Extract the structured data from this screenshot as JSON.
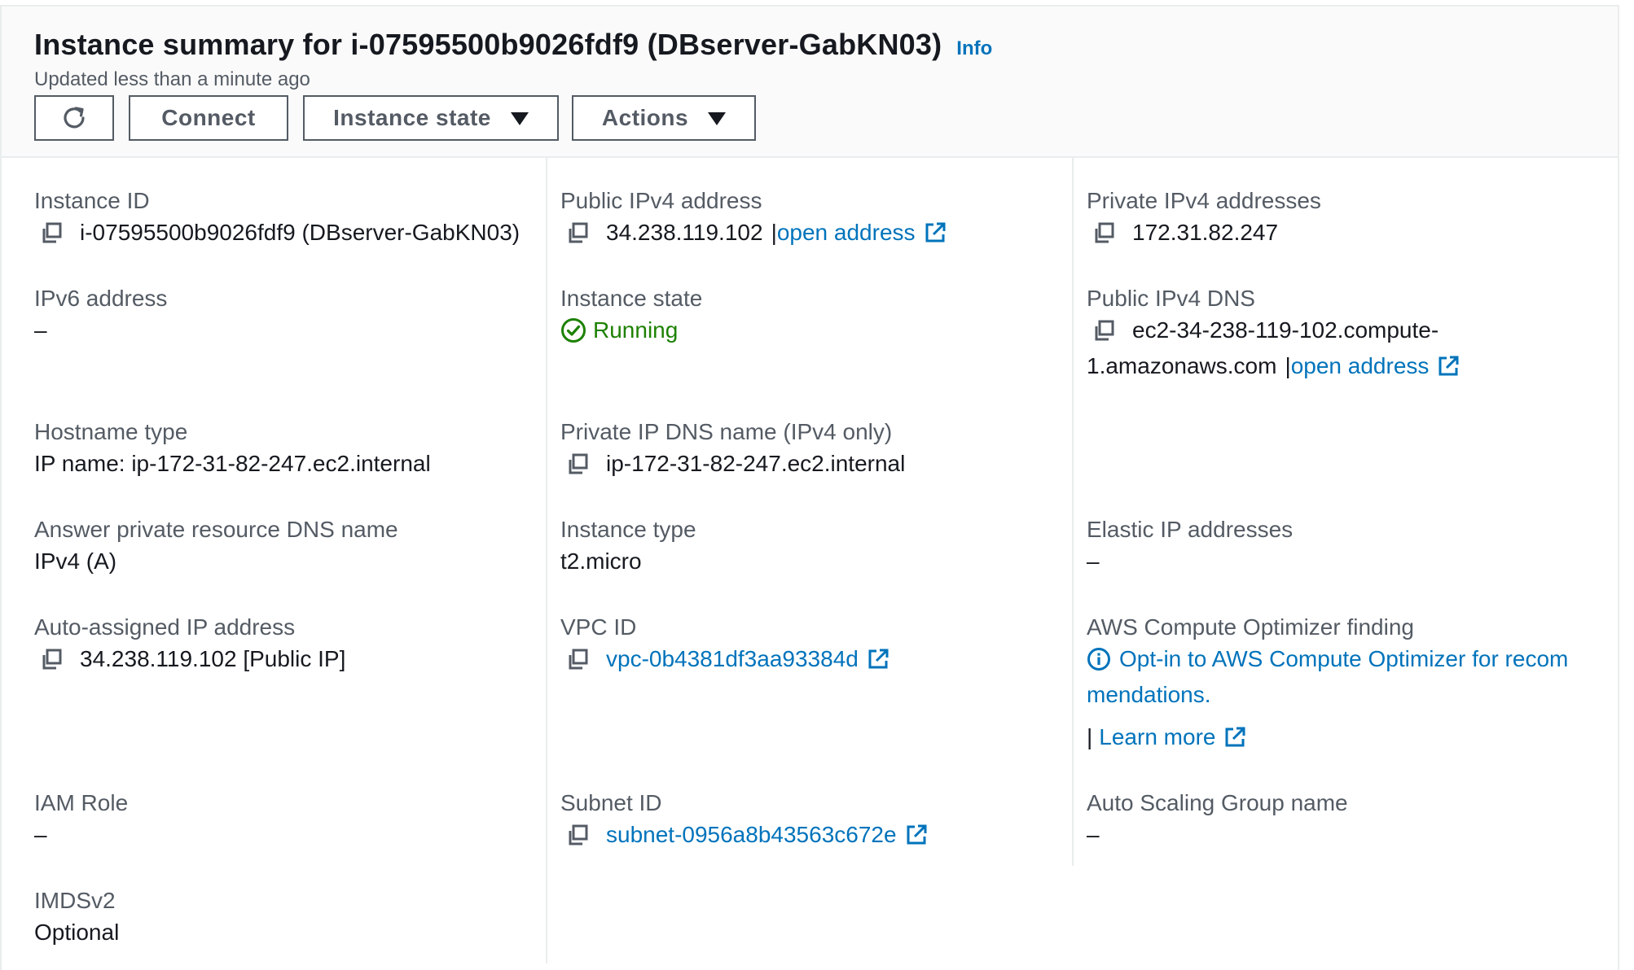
{
  "header": {
    "title": "Instance summary for i-07595500b9026fdf9 (DBserver-GabKN03)",
    "info_label": "Info",
    "updated_text": "Updated less than a minute ago",
    "buttons": {
      "refresh_icon": "refresh-icon",
      "connect": "Connect",
      "instance_state": "Instance state",
      "actions": "Actions"
    }
  },
  "fields": {
    "instance_id": {
      "label": "Instance ID",
      "value": "i-07595500b9026fdf9 (DBserver-GabKN03)"
    },
    "public_ipv4": {
      "label": "Public IPv4 address",
      "value": "34.238.119.102",
      "separator": "|",
      "link": "open address"
    },
    "private_ipv4": {
      "label": "Private IPv4 addresses",
      "value": "172.31.82.247"
    },
    "ipv6": {
      "label": "IPv6 address",
      "value": "–"
    },
    "instance_state": {
      "label": "Instance state",
      "value": "Running"
    },
    "public_dns": {
      "label": "Public IPv4 DNS",
      "value_line1": "ec2-34-238-119-102.compute-",
      "value_line2": "1.amazonaws.com",
      "separator": "|",
      "link": "open address"
    },
    "hostname_type": {
      "label": "Hostname type",
      "value": "IP name: ip-172-31-82-247.ec2.internal"
    },
    "private_dns": {
      "label": "Private IP DNS name (IPv4 only)",
      "value": "ip-172-31-82-247.ec2.internal"
    },
    "answer_dns": {
      "label": "Answer private resource DNS name",
      "value": "IPv4 (A)"
    },
    "instance_type": {
      "label": "Instance type",
      "value": "t2.micro"
    },
    "elastic_ip": {
      "label": "Elastic IP addresses",
      "value": "–"
    },
    "auto_ip": {
      "label": "Auto-assigned IP address",
      "value": "34.238.119.102 [Public IP]"
    },
    "vpc_id": {
      "label": "VPC ID",
      "value": "vpc-0b4381df3aa93384d"
    },
    "optimizer": {
      "label": "AWS Compute Optimizer finding",
      "link_line1": "Opt-in to AWS Compute Optimizer for recom",
      "link_line2": "mendations.",
      "separator": "|",
      "learn_more": "Learn more"
    },
    "iam_role": {
      "label": "IAM Role",
      "value": "–"
    },
    "subnet_id": {
      "label": "Subnet ID",
      "value": "subnet-0956a8b43563c672e"
    },
    "asg_name": {
      "label": "Auto Scaling Group name",
      "value": "–"
    },
    "imdsv2": {
      "label": "IMDSv2",
      "value": "Optional"
    }
  },
  "colors": {
    "link": "#0073bb",
    "running": "#1d8102",
    "label": "#545b64",
    "text": "#16191f",
    "border": "#eaeded"
  }
}
